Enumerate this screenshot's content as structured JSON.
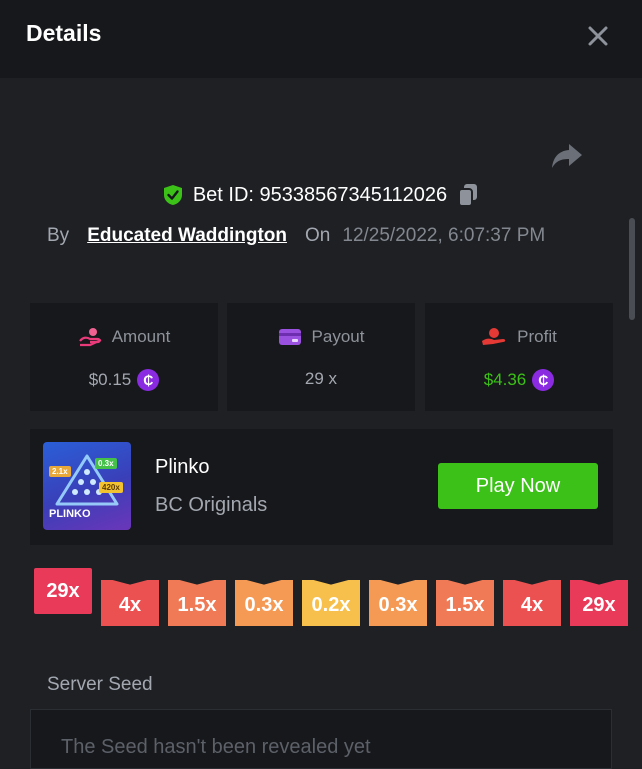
{
  "header": {
    "title": "Details"
  },
  "bet": {
    "id_label": "Bet ID: 95338567345112026",
    "by_label": "By",
    "user": "Educated Waddington",
    "on_label": "On",
    "date": "12/25/2022, 6:07:37 PM"
  },
  "stats": [
    {
      "label": "Amount",
      "value": "$0.15",
      "icon": "amount-icon",
      "value_color": "#a3a7b0",
      "coin": true
    },
    {
      "label": "Payout",
      "value": "29 x",
      "icon": "payout-icon",
      "value_color": "#a3a7b0",
      "coin": false
    },
    {
      "label": "Profit",
      "value": "$4.36",
      "icon": "profit-icon",
      "value_color": "#3bc117",
      "coin": true
    }
  ],
  "coin_symbol": "₵",
  "game": {
    "name": "Plinko",
    "provider": "BC Originals",
    "play_label": "Play Now",
    "thumb": {
      "title": "PLINKO",
      "tags": [
        "2.1x",
        "0.3x",
        "420x"
      ]
    }
  },
  "multipliers": [
    {
      "label": "29x",
      "color": "#e93a5a",
      "hit": true
    },
    {
      "label": "4x",
      "color": "#ec5151",
      "hit": false
    },
    {
      "label": "1.5x",
      "color": "#f07a55",
      "hit": false
    },
    {
      "label": "0.3x",
      "color": "#f59a55",
      "hit": false
    },
    {
      "label": "0.2x",
      "color": "#f7bf4c",
      "hit": false
    },
    {
      "label": "0.3x",
      "color": "#f59a55",
      "hit": false
    },
    {
      "label": "1.5x",
      "color": "#f07a55",
      "hit": false
    },
    {
      "label": "4x",
      "color": "#ec5151",
      "hit": false
    },
    {
      "label": "29x",
      "color": "#e93a5a",
      "hit": false
    }
  ],
  "server_seed": {
    "label": "Server Seed",
    "text": "The Seed hasn't been revealed yet"
  },
  "colors": {
    "accent_green": "#3bc117",
    "shield": "#3bc117",
    "coin": "#8a2be2"
  }
}
